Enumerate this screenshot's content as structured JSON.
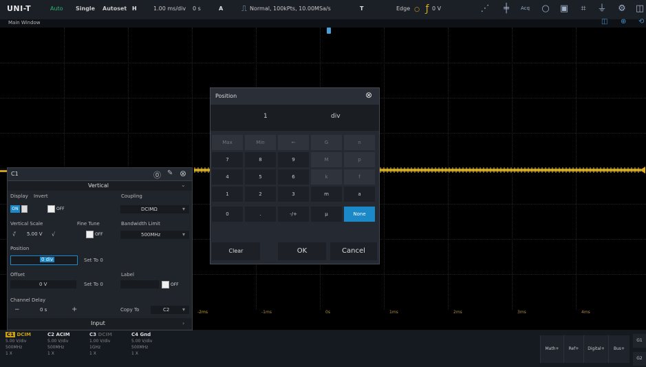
{
  "toolbar": {
    "logo": "UNI-T",
    "run_state": "Auto",
    "single": "Single",
    "autoset": "Autoset",
    "h_label": "H",
    "timebase": "1.00 ms/div",
    "h_offset": "0 s",
    "a_label": "A",
    "acq_info": "Normal, 100kPts, 10.00MSa/s",
    "t_label": "T",
    "trigger_type": "Edge",
    "trigger_level": "0 V",
    "acq_short": "Acq"
  },
  "window_title": "Main Window",
  "channel_panel": {
    "title": "C1",
    "vertical_header": "Vertical",
    "display_label": "Display",
    "display_on": "ON",
    "invert_label": "Invert",
    "invert_value": "OFF",
    "coupling_label": "Coupling",
    "coupling_value": "DCIMΩ",
    "vertical_scale_label": "Vertical Scale",
    "vertical_scale_value": "5.00 V",
    "fine_tune_label": "Fine Tune",
    "fine_tune_value": "OFF",
    "bandwidth_label": "Bandwidth Limit",
    "bandwidth_value": "500MHz",
    "position_label": "Position",
    "position_value": "0 div",
    "set_to_0": "Set To 0",
    "offset_label": "Offset",
    "offset_value": "0 V",
    "label_label": "Label",
    "label_value": "OFF",
    "channel_delay_label": "Channel Delay",
    "channel_delay_value": "0 s",
    "copy_to": "Copy To",
    "copy_target": "C2",
    "input_header": "Input"
  },
  "dialog": {
    "title": "Position",
    "entry": "1",
    "unit": "div",
    "keys": [
      [
        "Max",
        "Min",
        "←",
        "G",
        "n"
      ],
      [
        "7",
        "8",
        "9",
        "M",
        "p"
      ],
      [
        "4",
        "5",
        "6",
        "k",
        "f"
      ],
      [
        "1",
        "2",
        "3",
        "m",
        "a"
      ],
      [
        "0",
        ".",
        "-/+",
        "μ",
        "None"
      ]
    ],
    "clear": "Clear",
    "ok": "OK",
    "cancel": "Cancel"
  },
  "time_labels": [
    "-2ms",
    "-1ms",
    "0s",
    "1ms",
    "2ms",
    "3ms",
    "4ms"
  ],
  "channels": [
    {
      "name": "C1",
      "coupling": "DCIM",
      "scale": "5.00 V/div",
      "bw": "500MHz",
      "probe": "1 X",
      "color": "#e0b020"
    },
    {
      "name": "C2",
      "coupling": "ACIM",
      "scale": "5.00 V/div",
      "bw": "500MHz",
      "probe": "1 X",
      "color": "#9a9a9a"
    },
    {
      "name": "C3",
      "coupling": "DCIM",
      "scale": "1.00 V/div",
      "bw": "1GHz",
      "probe": "1 X",
      "color": "#9a9a9a"
    },
    {
      "name": "C4",
      "coupling": "Gnd",
      "scale": "5.00 V/div",
      "bw": "500MHz",
      "probe": "1 X",
      "color": "#9a9a9a"
    }
  ],
  "right_buttons": {
    "math": "Math+",
    "ref": "Ref+",
    "digital": "Digital+",
    "bus": "Bus+",
    "g1": "G1",
    "g2": "G2"
  }
}
